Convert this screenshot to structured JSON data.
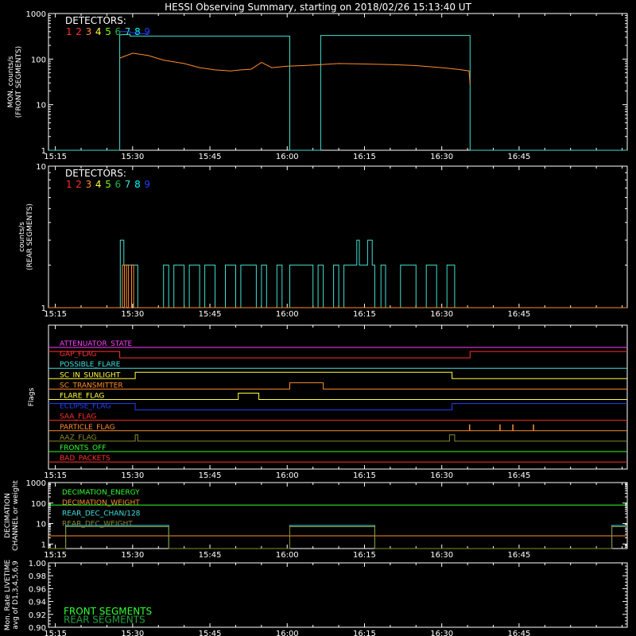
{
  "title": "HESSI Observing Summary, starting on 2018/02/26 15:13:40 UT",
  "time_ticks": [
    "15:15",
    "15:30",
    "15:45",
    "16:00",
    "16:15",
    "16:30",
    "16:45"
  ],
  "time_tick_minutes": [
    15,
    30,
    45,
    60,
    75,
    90,
    105
  ],
  "time_range_minutes": [
    13.67,
    126
  ],
  "detector_colors": [
    "#ff3030",
    "#ff3030",
    "#ff8c2a",
    "#ffff40",
    "#7cfc00",
    "#22b14c",
    "#40e0d0",
    "#00ffff",
    "#2040ff"
  ],
  "panels": {
    "front": {
      "ylabel_line1": "MON. counts/s",
      "ylabel_line2": "(FRONT SEGMENTS)",
      "yticks": [
        "1",
        "10",
        "100",
        "1000"
      ],
      "detectors_label": "DETECTORS:",
      "detector_numbers": [
        "1",
        "2",
        "3",
        "4",
        "5",
        "6",
        "7",
        "8",
        "9"
      ]
    },
    "rear": {
      "ylabel_line1": "counts/s",
      "ylabel_line2": "(REAR SEGMENTS)",
      "yticks": [
        "1",
        "10"
      ],
      "detectors_label": "DETECTORS:",
      "detector_numbers": [
        "1",
        "2",
        "3",
        "4",
        "5",
        "6",
        "7",
        "8",
        "9"
      ]
    },
    "flags": {
      "ylabel": "Flags",
      "items": [
        {
          "name": "ATTENUATOR_STATE",
          "color": "#ff40ff"
        },
        {
          "name": "GAP_FLAG",
          "color": "#ff3030"
        },
        {
          "name": "POSSIBLE_FLARE",
          "color": "#40e0e0"
        },
        {
          "name": "SC_IN_SUNLIGHT",
          "color": "#ffff40"
        },
        {
          "name": "SC_TRANSMITTER",
          "color": "#ff8c2a"
        },
        {
          "name": "FLARE_FLAG",
          "color": "#ffff40"
        },
        {
          "name": "ECLIPSE_FLAG",
          "color": "#2040ff"
        },
        {
          "name": "SAA_FLAG",
          "color": "#ff3030"
        },
        {
          "name": "PARTICLE_FLAG",
          "color": "#ff8c2a"
        },
        {
          "name": "AAZ_FLAG",
          "color": "#8a8a30"
        },
        {
          "name": "FRONTS_OFF",
          "color": "#30ff30"
        },
        {
          "name": "BAD_PACKETS",
          "color": "#ff3030"
        }
      ]
    },
    "decimation": {
      "ylabel_line1": "DECIMATION",
      "ylabel_line2": "CHANNEL or weight",
      "yticks": [
        "1",
        "10",
        "100",
        "1000"
      ],
      "legend": [
        {
          "name": "DECIMATION_ENERGY",
          "color": "#30ff30"
        },
        {
          "name": "DECIMATION_WEIGHT",
          "color": "#ff8c2a"
        },
        {
          "name": "REAR_DEC_CHAN/128",
          "color": "#40e0e0"
        },
        {
          "name": "REAR_DEC_WEIGHT",
          "color": "#8a8a30"
        }
      ]
    },
    "livetime": {
      "ylabel_line1": "Mon. Rate LIVETIME",
      "ylabel_line2": "avg of D1,3,4,5,6,9",
      "yticks": [
        "0.90",
        "0.92",
        "0.94",
        "0.96",
        "0.98",
        "1.00"
      ],
      "legend": [
        {
          "name": "FRONT SEGMENTS",
          "color": "#30ff30"
        },
        {
          "name": "REAR SEGMENTS",
          "color": "#22a040"
        }
      ]
    }
  },
  "chart_data": [
    {
      "type": "line",
      "ylabel": "MON. counts/s (FRONT SEGMENTS)",
      "yscale": "log",
      "ylim": [
        1,
        1000
      ],
      "series": [
        {
          "name": "8",
          "color": "#40e0d0",
          "x": [
            13.67,
            27.5,
            27.5,
            29.5,
            29.5,
            60.5,
            60.5,
            66.5,
            66.5,
            95.5,
            95.5,
            126
          ],
          "y": [
            1,
            1,
            340,
            350,
            320,
            320,
            1,
            1,
            330,
            330,
            1,
            1
          ]
        },
        {
          "name": "9",
          "color": "#2040ff",
          "x": [
            27.5,
            29.5,
            29.5,
            31,
            31,
            33
          ],
          "y": [
            400,
            400,
            380,
            380,
            360,
            360
          ]
        },
        {
          "name": "3",
          "color": "#ff8c2a",
          "x": [
            27.5,
            30,
            33,
            36,
            40,
            43,
            46,
            49,
            51,
            53,
            55,
            57,
            60,
            63,
            66,
            70,
            75,
            80,
            85,
            90,
            93,
            95.3,
            95.5
          ],
          "y": [
            105,
            135,
            120,
            95,
            80,
            65,
            58,
            55,
            58,
            60,
            85,
            65,
            70,
            72,
            75,
            80,
            78,
            76,
            72,
            65,
            60,
            55,
            28
          ]
        }
      ]
    },
    {
      "type": "line",
      "ylabel": "counts/s (REAR SEGMENTS)",
      "yscale": "log",
      "ylim": [
        1,
        10
      ],
      "series": [
        {
          "name": "8",
          "color": "#40e0d0",
          "x": [
            13.67,
            27.6,
            27.6,
            28.3,
            28.3,
            31,
            31,
            36,
            36,
            37,
            37,
            38,
            38,
            40,
            40,
            41,
            41,
            43,
            43,
            44,
            44,
            46,
            46,
            48,
            48,
            50,
            50,
            51,
            51,
            54,
            54,
            55,
            55,
            56,
            56,
            58,
            58,
            59,
            59,
            60.5,
            60.5,
            65,
            65,
            66,
            66,
            67,
            67,
            69,
            69,
            70,
            70,
            71,
            71,
            73.5,
            73.5,
            74,
            74,
            75.6,
            75.6,
            76.5,
            76.5,
            77,
            77,
            78.2,
            78.2,
            79.1,
            79.1,
            82,
            82,
            85,
            85,
            87,
            87,
            89,
            89,
            91,
            91,
            92.5,
            92.5,
            126
          ],
          "y": [
            1,
            1,
            3,
            3,
            2,
            2,
            1,
            1,
            2,
            2,
            1,
            1,
            2,
            2,
            1,
            1,
            2,
            2,
            1,
            1,
            2,
            2,
            1,
            1,
            2,
            2,
            1,
            1,
            2,
            2,
            1,
            1,
            2,
            2,
            1,
            1,
            2,
            2,
            1,
            1,
            2,
            2,
            1,
            1,
            2,
            2,
            1,
            1,
            2,
            2,
            1,
            1,
            2,
            2,
            3,
            3,
            2,
            2,
            3,
            3,
            2,
            2,
            1,
            1,
            2,
            2,
            1,
            1,
            2,
            2,
            1,
            1,
            2,
            2,
            1,
            1,
            2,
            2,
            1,
            1
          ]
        },
        {
          "name": "3",
          "color": "#ff8c2a",
          "x": [
            13.67,
            28,
            28,
            28.4,
            28.4,
            28.8,
            28.8,
            29.2,
            29.2,
            29.8,
            29.8,
            30.2,
            30.2,
            126
          ],
          "y": [
            1,
            1,
            2,
            2,
            1,
            1,
            2,
            2,
            1,
            1,
            2,
            2,
            1,
            1
          ]
        }
      ]
    },
    {
      "type": "line",
      "ylabel": "Flags",
      "series": [
        {
          "name": "ATTENUATOR_STATE",
          "x": [
            13.67,
            126
          ],
          "y": [
            0,
            0
          ]
        },
        {
          "name": "GAP_FLAG",
          "x": [
            13.67,
            27.5,
            27.5,
            95.5,
            95.5,
            126
          ],
          "y": [
            1,
            1,
            0,
            0,
            1,
            1
          ]
        },
        {
          "name": "POSSIBLE_FLARE",
          "x": [
            13.67,
            126
          ],
          "y": [
            0,
            0
          ]
        },
        {
          "name": "SC_IN_SUNLIGHT",
          "x": [
            13.67,
            30.5,
            30.5,
            92,
            92,
            126
          ],
          "y": [
            0,
            0,
            1,
            1,
            0,
            0
          ]
        },
        {
          "name": "SC_TRANSMITTER",
          "x": [
            13.67,
            60.5,
            60.5,
            67,
            67,
            126
          ],
          "y": [
            0,
            0,
            1,
            1,
            0,
            0
          ]
        },
        {
          "name": "FLARE_FLAG",
          "x": [
            13.67,
            50.5,
            50.5,
            54.5,
            54.5,
            126
          ],
          "y": [
            0,
            0,
            1,
            1,
            0,
            0
          ]
        },
        {
          "name": "ECLIPSE_FLAG",
          "x": [
            13.67,
            30.5,
            30.5,
            92,
            92,
            126
          ],
          "y": [
            1,
            1,
            0,
            0,
            1,
            1
          ]
        },
        {
          "name": "SAA_FLAG",
          "x": [
            13.67,
            126
          ],
          "y": [
            0,
            0
          ]
        },
        {
          "name": "PARTICLE_FLAG",
          "x": [
            13.67,
            126
          ],
          "y": [
            0,
            0
          ],
          "spikes": [
            95.4,
            101.3,
            103.8,
            107.8
          ]
        },
        {
          "name": "AAZ_FLAG",
          "x": [
            13.67,
            30.5,
            30.5,
            31,
            31,
            91.5,
            91.5,
            92.5,
            92.5,
            126
          ],
          "y": [
            0,
            0,
            1,
            1,
            0,
            0,
            1,
            1,
            0,
            0
          ]
        },
        {
          "name": "FRONTS_OFF",
          "x": [
            13.67,
            126
          ],
          "y": [
            0,
            0
          ]
        },
        {
          "name": "BAD_PACKETS",
          "x": [
            13.67,
            126
          ],
          "y": [
            0,
            0
          ]
        }
      ]
    },
    {
      "type": "line",
      "ylabel": "DECIMATION CHANNEL or weight",
      "yscale": "log",
      "ylim": [
        0.6,
        1000
      ],
      "series": [
        {
          "name": "DECIMATION_ENERGY",
          "x": [
            13.67,
            126
          ],
          "y": [
            80,
            80
          ]
        },
        {
          "name": "DECIMATION_WEIGHT",
          "x": [
            13.67,
            126
          ],
          "y": [
            2.5,
            2.5
          ]
        },
        {
          "name": "REAR_DEC_CHAN/128",
          "x": [
            13.67,
            17,
            17,
            37,
            37,
            60.5,
            60.5,
            77,
            77,
            123,
            123,
            126
          ],
          "y": [
            0.6,
            0.6,
            8,
            8,
            0.6,
            0.6,
            8,
            8,
            0.6,
            0.6,
            8,
            8
          ]
        },
        {
          "name": "REAR_DEC_WEIGHT",
          "x": [
            13.67,
            17,
            17,
            37,
            37,
            60.5,
            60.5,
            77,
            77,
            123,
            123,
            126
          ],
          "y": [
            0.6,
            0.6,
            7,
            7,
            0.6,
            0.6,
            7,
            7,
            0.6,
            0.6,
            7,
            7
          ]
        }
      ]
    },
    {
      "type": "line",
      "ylabel": "Mon. Rate LIVETIME avg of D1,3,4,5,6,9",
      "ylim": [
        0.9,
        1.0
      ],
      "series": []
    }
  ]
}
